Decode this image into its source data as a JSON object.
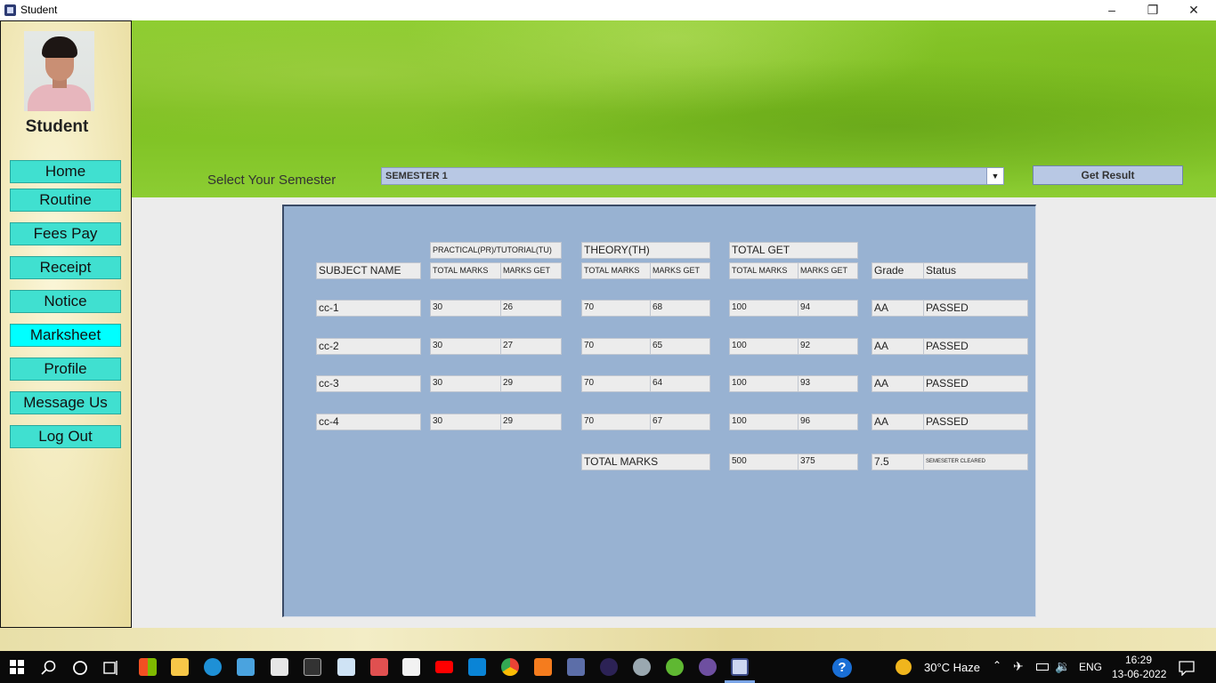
{
  "window": {
    "title": "Student",
    "minimize": "–",
    "restore": "❐",
    "close": "✕"
  },
  "sidebar": {
    "title": "Student",
    "items": [
      {
        "label": "Home"
      },
      {
        "label": "Routine"
      },
      {
        "label": "Fees Pay"
      },
      {
        "label": "Receipt"
      },
      {
        "label": "Notice"
      },
      {
        "label": "Marksheet",
        "active": true
      },
      {
        "label": "Profile"
      },
      {
        "label": "Message Us"
      },
      {
        "label": "Log Out"
      }
    ]
  },
  "semester": {
    "label": "Select Your Semester",
    "selected": "SEMESTER 1",
    "arrow": "▼",
    "button": "Get Result"
  },
  "marksheet": {
    "groups": {
      "practical": "PRACTICAL(PR)/TUTORIAL(TU)",
      "theory": "THEORY(TH)",
      "total": "TOTAL GET"
    },
    "headers": {
      "subject": "SUBJECT NAME",
      "pr_total": "TOTAL MARKS",
      "pr_get": "MARKS GET",
      "th_total": "TOTAL MARKS",
      "th_get": "MARKS GET",
      "tot_total": "TOTAL MARKS",
      "tot_get": "MARKS GET",
      "grade": "Grade",
      "status": "Status"
    },
    "rows": [
      {
        "subject": "cc-1",
        "pr_total": "30",
        "pr_get": "26",
        "th_total": "70",
        "th_get": "68",
        "tot_total": "100",
        "tot_get": "94",
        "grade": "AA",
        "status": "PASSED"
      },
      {
        "subject": "cc-2",
        "pr_total": "30",
        "pr_get": "27",
        "th_total": "70",
        "th_get": "65",
        "tot_total": "100",
        "tot_get": "92",
        "grade": "AA",
        "status": "PASSED"
      },
      {
        "subject": "cc-3",
        "pr_total": "30",
        "pr_get": "29",
        "th_total": "70",
        "th_get": "64",
        "tot_total": "100",
        "tot_get": "93",
        "grade": "AA",
        "status": "PASSED"
      },
      {
        "subject": "cc-4",
        "pr_total": "30",
        "pr_get": "29",
        "th_total": "70",
        "th_get": "67",
        "tot_total": "100",
        "tot_get": "96",
        "grade": "AA",
        "status": "PASSED"
      }
    ],
    "summary": {
      "label": "TOTAL MARKS",
      "total": "500",
      "obtained": "375",
      "grade": "7.5",
      "status": "SEMESETER CLEARED"
    }
  },
  "taskbar": {
    "icons": [
      "windows-start-icon",
      "search-icon",
      "cortana-icon",
      "task-view-icon",
      "microsoft-store-icon",
      "file-explorer-icon",
      "edge-icon",
      "remote-desktop-icon",
      "mail-icon",
      "terminal-icon",
      "notepad-icon",
      "snipping-tool-icon",
      "wordpad-icon",
      "youtube-icon",
      "vscode-icon",
      "chrome-icon",
      "xampp-icon",
      "ide-icon",
      "eclipse-icon",
      "game-icon",
      "utorrent-icon",
      "netbeans-icon",
      "java-app-icon"
    ],
    "help": "?",
    "weather": "30°C  Haze",
    "lang": "ENG",
    "time": "16:29",
    "date": "13-06-2022"
  }
}
